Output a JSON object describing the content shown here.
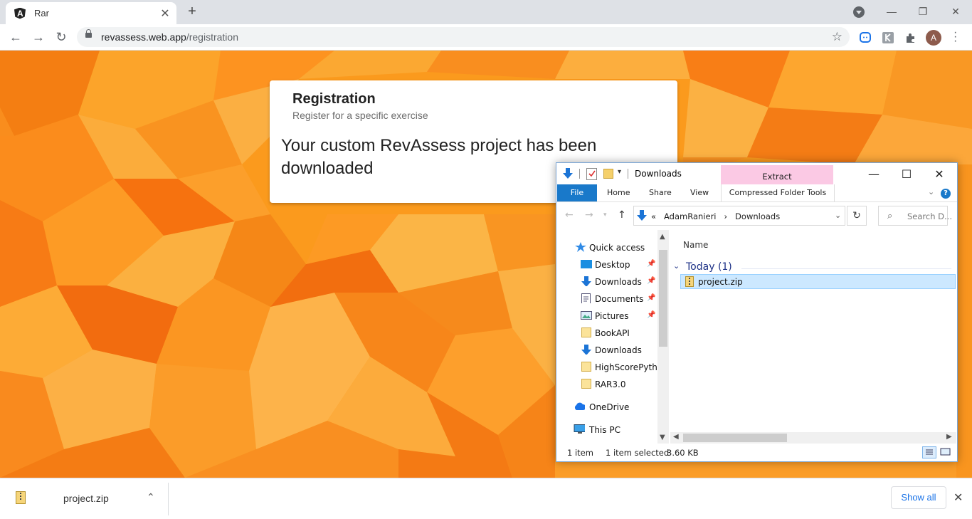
{
  "browser": {
    "tab_title": "Rar",
    "tab_favicon_letter": "A",
    "url_host": "revassess.web.app",
    "url_path": "/registration",
    "avatar_letter": "A"
  },
  "card": {
    "title": "Registration",
    "subtitle": "Register for a specific exercise",
    "message": "Your custom RevAssess project has been downloaded"
  },
  "explorer": {
    "title": "Downloads",
    "extract_tab": "Extract",
    "ribbon": {
      "file": "File",
      "home": "Home",
      "share": "Share",
      "view": "View",
      "tools": "Compressed Folder Tools"
    },
    "address": {
      "prefix": "«",
      "crumb1": "AdamRanieri",
      "sep": "›",
      "crumb2": "Downloads"
    },
    "search_placeholder": "Search D...",
    "nav": [
      {
        "label": "Quick access"
      },
      {
        "label": "Desktop"
      },
      {
        "label": "Downloads"
      },
      {
        "label": "Documents"
      },
      {
        "label": "Pictures"
      },
      {
        "label": "BookAPI"
      },
      {
        "label": "Downloads"
      },
      {
        "label": "HighScorePytho"
      },
      {
        "label": "RAR3.0"
      },
      {
        "label": "OneDrive"
      },
      {
        "label": "This PC"
      }
    ],
    "column_header": "Name",
    "group_label": "Today (1)",
    "file_name": "project.zip",
    "status": {
      "items": "1 item",
      "selected": "1 item selected",
      "size": "3.60 KB"
    }
  },
  "shelf": {
    "file_name": "project.zip",
    "show_all": "Show all"
  }
}
